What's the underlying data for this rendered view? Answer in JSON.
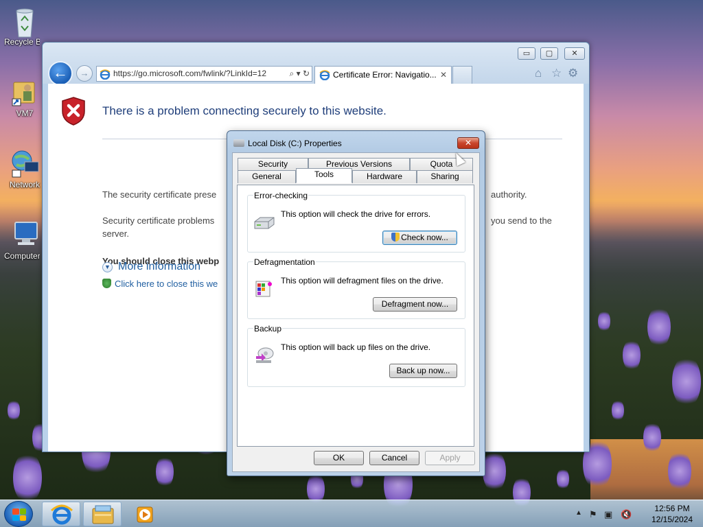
{
  "desktop": {
    "icons": [
      {
        "label": "Recycle Bin",
        "icon": "recycle-bin-icon"
      },
      {
        "label": "VM7",
        "icon": "folder-user-icon"
      },
      {
        "label": "Network",
        "icon": "network-icon"
      },
      {
        "label": "Computer",
        "icon": "computer-icon"
      }
    ]
  },
  "browser": {
    "address": "https://go.microsoft.com/fwlink/?LinkId=12",
    "tab_title": "Certificate Error: Navigatio...",
    "tab_close": "✕",
    "heading": "There is a problem connecting securely to this website.",
    "para1_left": "The security certificate prese",
    "para1_right": "authority.",
    "para2_left": "Security certificate problems",
    "para2_right": "you send to the",
    "para2_line2": "server.",
    "close_warning": "You should close this webp",
    "close_link": "Click here to close this we",
    "more_info": "More information",
    "controls": {
      "minimize": "▭",
      "maximize": "▢",
      "close": "✕"
    },
    "toolbar_icons": [
      "home-icon",
      "star-icon",
      "gear-icon"
    ]
  },
  "dialog": {
    "title": "Local Disk (C:) Properties",
    "close": "✕",
    "tabs_top": [
      "Security",
      "Previous Versions",
      "Quota"
    ],
    "tabs_bottom": [
      "General",
      "Tools",
      "Hardware",
      "Sharing"
    ],
    "selected_tab": "Tools",
    "groups": {
      "error_checking": {
        "label": "Error-checking",
        "text": "This option will check the drive for errors.",
        "button": "Check now..."
      },
      "defrag": {
        "label": "Defragmentation",
        "text": "This option will defragment files on the drive.",
        "button": "Defragment now..."
      },
      "backup": {
        "label": "Backup",
        "text": "This option will back up files on the drive.",
        "button": "Back up now..."
      }
    },
    "buttons": {
      "ok": "OK",
      "cancel": "Cancel",
      "apply": "Apply"
    }
  },
  "taskbar": {
    "time": "12:56 PM",
    "date": "12/15/2024",
    "pinned": [
      "internet-explorer-icon",
      "file-explorer-icon",
      "media-player-icon"
    ]
  }
}
